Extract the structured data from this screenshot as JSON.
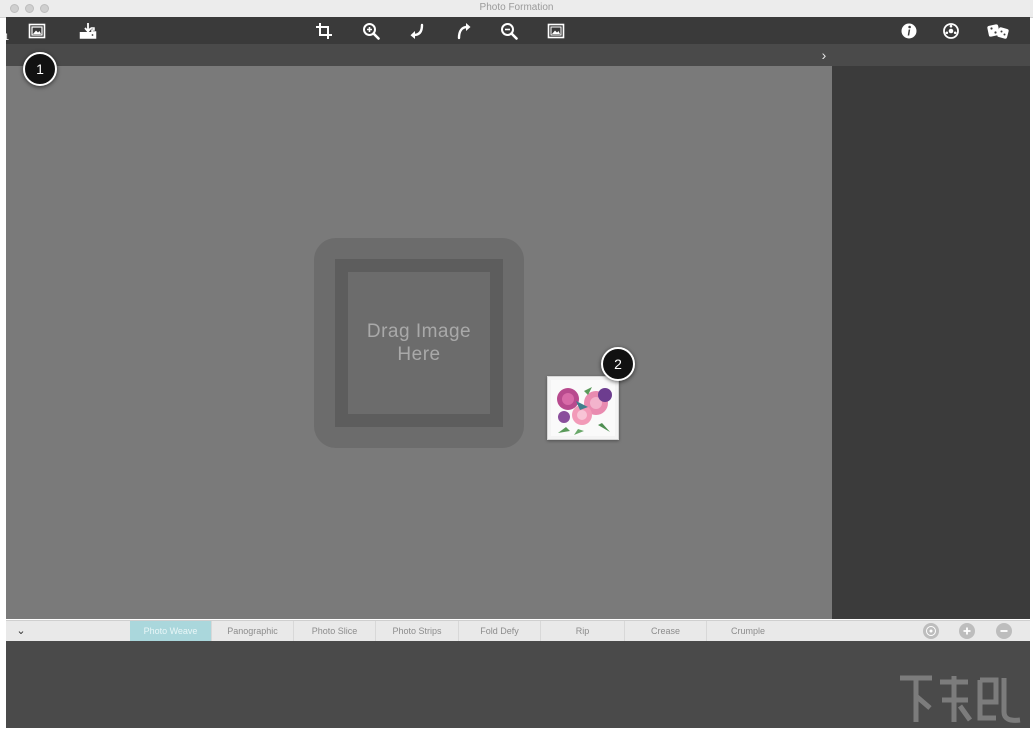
{
  "window": {
    "title": "Photo Formation"
  },
  "toolbar": {
    "left_icons": [
      "open-image-icon",
      "save-icon"
    ],
    "center_icons": [
      "crop-icon",
      "zoom-in-icon",
      "rotate-left-icon",
      "rotate-right-icon",
      "zoom-out-icon",
      "fit-image-icon"
    ],
    "right_icons": [
      "info-icon",
      "settings-icon",
      "share-icon"
    ]
  },
  "corner_mark": "1",
  "canvas": {
    "drop_zone_text": "Drag Image\nHere",
    "background": "#7a7a7a"
  },
  "callouts": [
    {
      "label": "1"
    },
    {
      "label": "2"
    }
  ],
  "tabs": [
    {
      "label": "Photo Weave",
      "active": true
    },
    {
      "label": "Panographic"
    },
    {
      "label": "Photo Slice"
    },
    {
      "label": "Photo Strips"
    },
    {
      "label": "Fold Defy"
    },
    {
      "label": "Rip"
    },
    {
      "label": "Crease"
    },
    {
      "label": "Crumple"
    }
  ],
  "tab_actions": [
    "settings-icon",
    "add-icon",
    "remove-icon"
  ],
  "colors": {
    "active_tab": "#aad7dc",
    "toolbar": "#3a3a3a",
    "right_panel": "#3b3b3b"
  }
}
